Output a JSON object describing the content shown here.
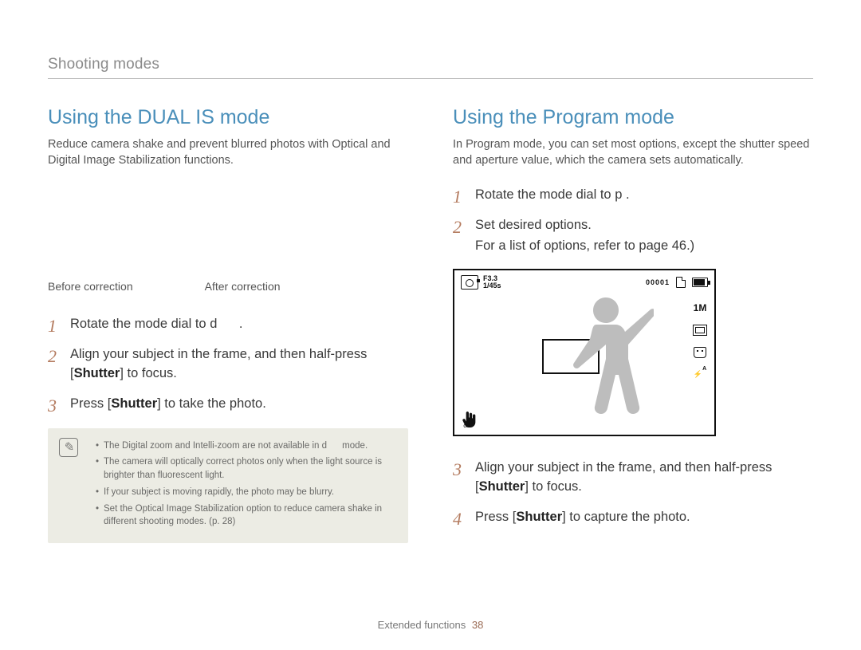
{
  "breadcrumb": "Shooting modes",
  "left": {
    "heading": "Using the DUAL IS mode",
    "intro": "Reduce camera shake and prevent blurred photos with Optical and Digital Image Stabilization functions.",
    "caption_before": "Before correction",
    "caption_after": "After correction",
    "steps": [
      {
        "pre": "Rotate the mode dial to ",
        "icon": "d",
        "post": "."
      },
      {
        "pre": "Align your subject in the frame, and then half-press [",
        "bold": "Shutter",
        "post": "] to focus."
      },
      {
        "pre": "Press [",
        "bold": "Shutter",
        "post": "] to take the photo."
      }
    ],
    "notes": [
      {
        "pre": "The Digital zoom and Intelli-zoom are not available in ",
        "icon": "d",
        "post": " mode."
      },
      {
        "text": "The camera will optically correct photos only when the light source is brighter than fluorescent light."
      },
      {
        "text": "If your subject is moving rapidly, the photo may be blurry."
      },
      {
        "text": "Set the Optical Image Stabilization option to reduce camera shake in different shooting modes. (p. 28)"
      }
    ]
  },
  "right": {
    "heading": "Using the Program mode",
    "intro": "In Program mode, you can set most options, except the shutter speed and aperture value, which the camera sets automatically.",
    "steps_a": [
      {
        "pre": "Rotate the mode dial to ",
        "icon": "p",
        "post": " ."
      },
      {
        "pre": "Set desired options.",
        "sub": "For a list of options, refer to page 46.)"
      }
    ],
    "lcd": {
      "aperture": "F3.3",
      "shutter": "1/45s",
      "counter": "00001",
      "size_label": "1M",
      "flash_sup": "A",
      "ois_label": "OIS"
    },
    "steps_b": [
      {
        "pre": "Align your subject in the frame, and then half-press [",
        "bold": "Shutter",
        "post": "] to focus."
      },
      {
        "pre": "Press [",
        "bold": "Shutter",
        "post": "] to capture the photo."
      }
    ]
  },
  "footer": {
    "section": "Extended functions",
    "page": "38"
  }
}
